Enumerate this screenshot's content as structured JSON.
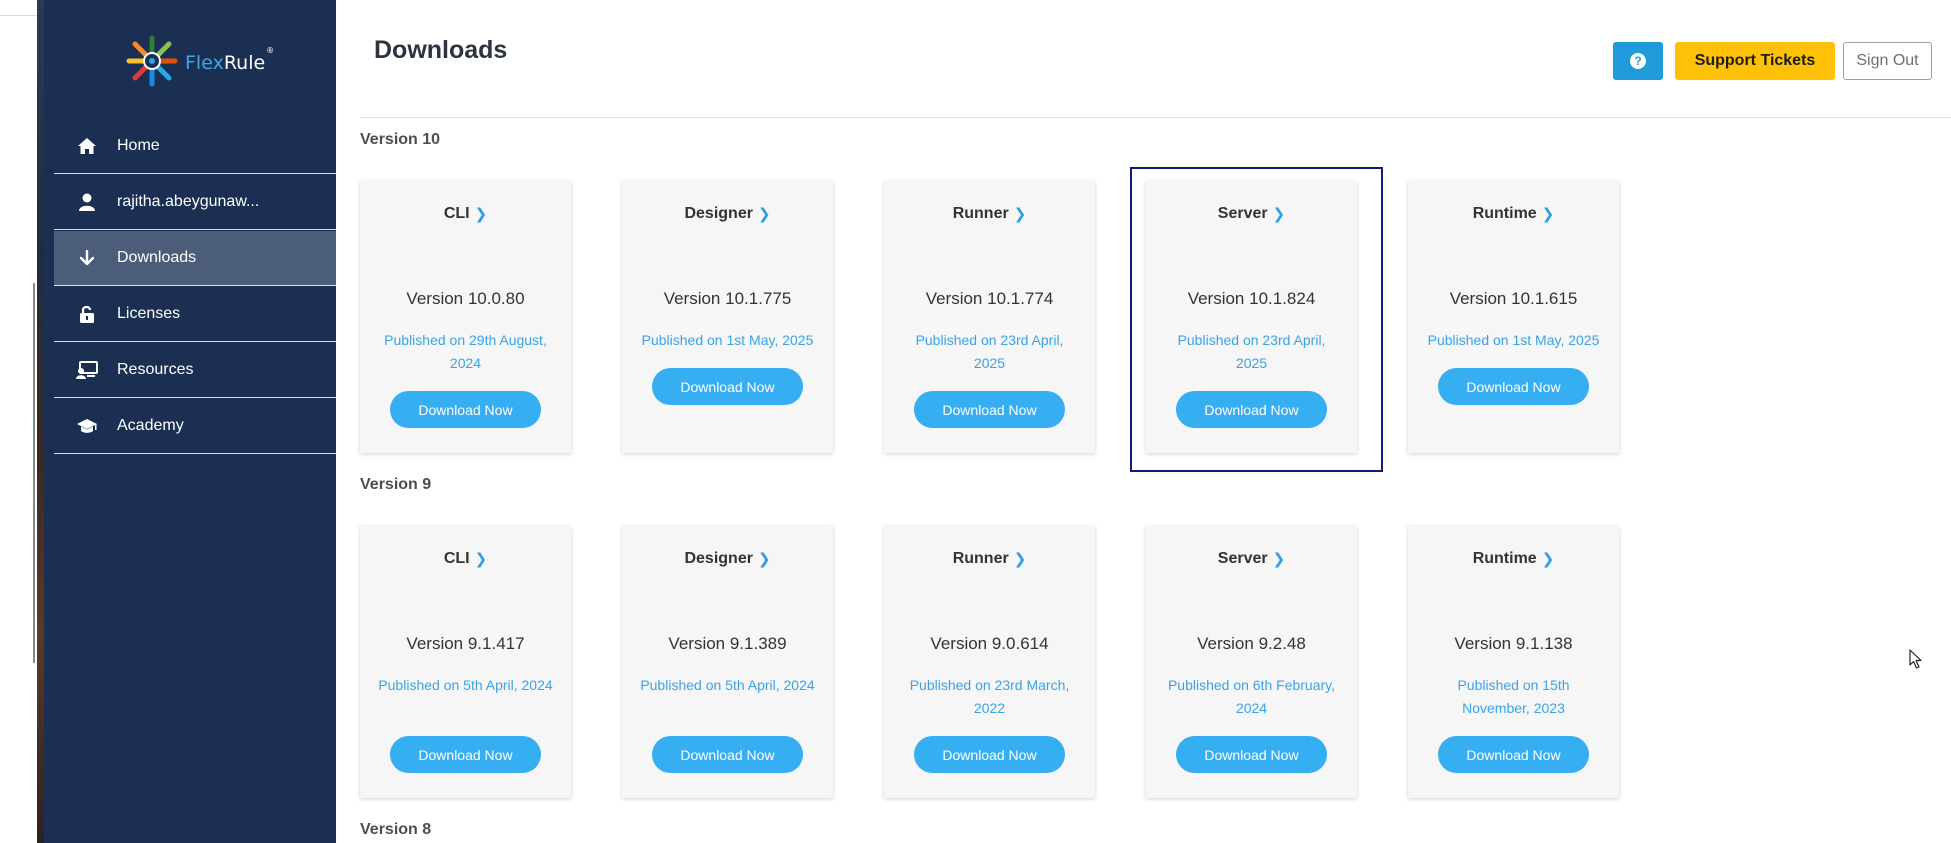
{
  "brand": {
    "name_part1": "Flex",
    "name_part2": "Rule",
    "mark": "®"
  },
  "sidebar": {
    "items": [
      {
        "label": "Home",
        "icon": "home-icon"
      },
      {
        "label": "rajitha.abeygunaw...",
        "icon": "user-icon"
      },
      {
        "label": "Downloads",
        "icon": "download-arrow-icon",
        "active": true
      },
      {
        "label": "Licenses",
        "icon": "unlock-icon"
      },
      {
        "label": "Resources",
        "icon": "desktop-user-icon"
      },
      {
        "label": "Academy",
        "icon": "graduation-cap-icon"
      }
    ]
  },
  "header": {
    "title": "Downloads",
    "help_label": "?",
    "support_label": "Support Tickets",
    "signout_label": "Sign Out"
  },
  "sections": [
    {
      "label": "Version 10",
      "cards": [
        {
          "name": "CLI",
          "version": "Version 10.0.80",
          "published": "Published on 29th August, 2024",
          "button": "Download Now"
        },
        {
          "name": "Designer",
          "version": "Version 10.1.775",
          "published": "Published on 1st May, 2025",
          "button": "Download Now"
        },
        {
          "name": "Runner",
          "version": "Version 10.1.774",
          "published": "Published on 23rd April, 2025",
          "button": "Download Now"
        },
        {
          "name": "Server",
          "version": "Version 10.1.824",
          "published": "Published on 23rd April, 2025",
          "button": "Download Now"
        },
        {
          "name": "Runtime",
          "version": "Version 10.1.615",
          "published": "Published on 1st May, 2025",
          "button": "Download Now"
        }
      ]
    },
    {
      "label": "Version 9",
      "cards": [
        {
          "name": "CLI",
          "version": "Version 9.1.417",
          "published": "Published on 5th April, 2024",
          "button": "Download Now"
        },
        {
          "name": "Designer",
          "version": "Version 9.1.389",
          "published": "Published on 5th April, 2024",
          "button": "Download Now"
        },
        {
          "name": "Runner",
          "version": "Version 9.0.614",
          "published": "Published on 23rd March, 2022",
          "button": "Download Now"
        },
        {
          "name": "Server",
          "version": "Version 9.2.48",
          "published": "Published on 6th February, 2024",
          "button": "Download Now"
        },
        {
          "name": "Runtime",
          "version": "Version 9.1.138",
          "published": "Published on 15th November, 2023",
          "button": "Download Now"
        }
      ]
    },
    {
      "label": "Version 8",
      "cards": []
    }
  ],
  "colors": {
    "sidebar_bg": "#1b2f52",
    "accent_blue": "#36aef2",
    "support_yellow": "#ffc107",
    "highlight_border": "#0f1a7a"
  }
}
